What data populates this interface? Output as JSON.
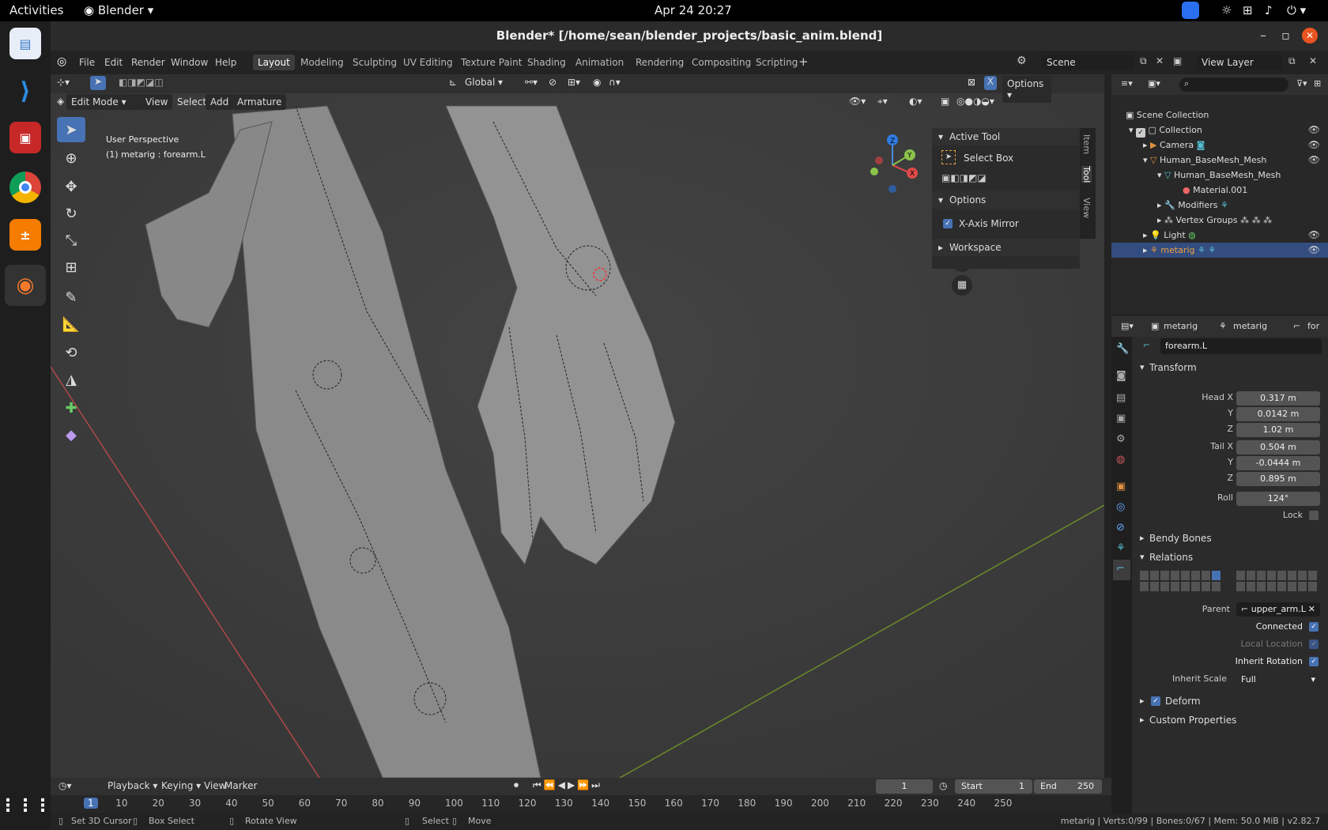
{
  "system": {
    "activities": "Activities",
    "app_menu": "Blender",
    "datetime": "Apr 24  20:27"
  },
  "window": {
    "title": "Blender* [/home/sean/blender_projects/basic_anim.blend]"
  },
  "menu": {
    "items": [
      "File",
      "Edit",
      "Render",
      "Window",
      "Help"
    ]
  },
  "workspaces": [
    "Layout",
    "Modeling",
    "Sculpting",
    "UV Editing",
    "Texture Paint",
    "Shading",
    "Animation",
    "Rendering",
    "Compositing",
    "Scripting"
  ],
  "scene": {
    "label": "Scene",
    "view_layer": "View Layer"
  },
  "viewport": {
    "orientation": "Global",
    "mode": "Edit Mode",
    "menus": [
      "View",
      "Select",
      "Add",
      "Armature"
    ],
    "perspective": "User Perspective",
    "active_info": "(1) metarig : forearm.L",
    "options_label": "Options",
    "x_label": "X"
  },
  "npanel": {
    "active_tool_header": "Active Tool",
    "tool_name": "Select Box",
    "options_header": "Options",
    "x_axis_mirror": "X-Axis Mirror",
    "workspace_header": "Workspace",
    "tabs": [
      "Item",
      "Tool",
      "View"
    ]
  },
  "outliner": {
    "rows": [
      {
        "label": "Scene Collection"
      },
      {
        "label": "Collection"
      },
      {
        "label": "Camera"
      },
      {
        "label": "Human_BaseMesh_Mesh"
      },
      {
        "label": "Human_BaseMesh_Mesh"
      },
      {
        "label": "Material.001"
      },
      {
        "label": "Modifiers"
      },
      {
        "label": "Vertex Groups"
      },
      {
        "label": "Light"
      },
      {
        "label": "metarig"
      }
    ]
  },
  "properties": {
    "breadcrumb": [
      "metarig",
      "metarig",
      "for"
    ],
    "bone_name": "forearm.L",
    "transform_header": "Transform",
    "head_x_label": "Head X",
    "head_x": "0.317 m",
    "head_y": "0.0142 m",
    "head_z": "1.02 m",
    "tail_x_label": "Tail X",
    "tail_x": "0.504 m",
    "tail_y": "-0.0444 m",
    "tail_z": "0.895 m",
    "y_label": "Y",
    "z_label": "Z",
    "roll_label": "Roll",
    "roll": "124°",
    "lock_label": "Lock",
    "bendy_header": "Bendy Bones",
    "relations_header": "Relations",
    "parent_label": "Parent",
    "parent": "upper_arm.L",
    "connected": "Connected",
    "local_location": "Local Location",
    "inherit_rotation": "Inherit Rotation",
    "inherit_scale_label": "Inherit Scale",
    "inherit_scale": "Full",
    "deform_header": "Deform",
    "custom_props_header": "Custom Properties"
  },
  "timeline": {
    "menus": [
      "Playback",
      "Keying",
      "View",
      "Marker"
    ],
    "current_frame": "1",
    "start_label": "Start",
    "start": "1",
    "end_label": "End",
    "end": "250",
    "ruler": [
      "1",
      "10",
      "20",
      "30",
      "40",
      "50",
      "60",
      "70",
      "80",
      "90",
      "100",
      "110",
      "120",
      "130",
      "140",
      "150",
      "160",
      "170",
      "180",
      "190",
      "200",
      "210",
      "220",
      "230",
      "240",
      "250"
    ]
  },
  "statusbar": {
    "hints": [
      "Set 3D Cursor",
      "Box Select",
      "Rotate View",
      "Select",
      "Move"
    ],
    "stats": "metarig | Verts:0/99 | Bones:0/67 | Mem: 50.0 MiB | v2.82.7"
  },
  "colors": {
    "accent": "#4772b3",
    "header": "#232323",
    "viewport_bg": "#3d3d3d",
    "panel": "#2b2b2b"
  }
}
